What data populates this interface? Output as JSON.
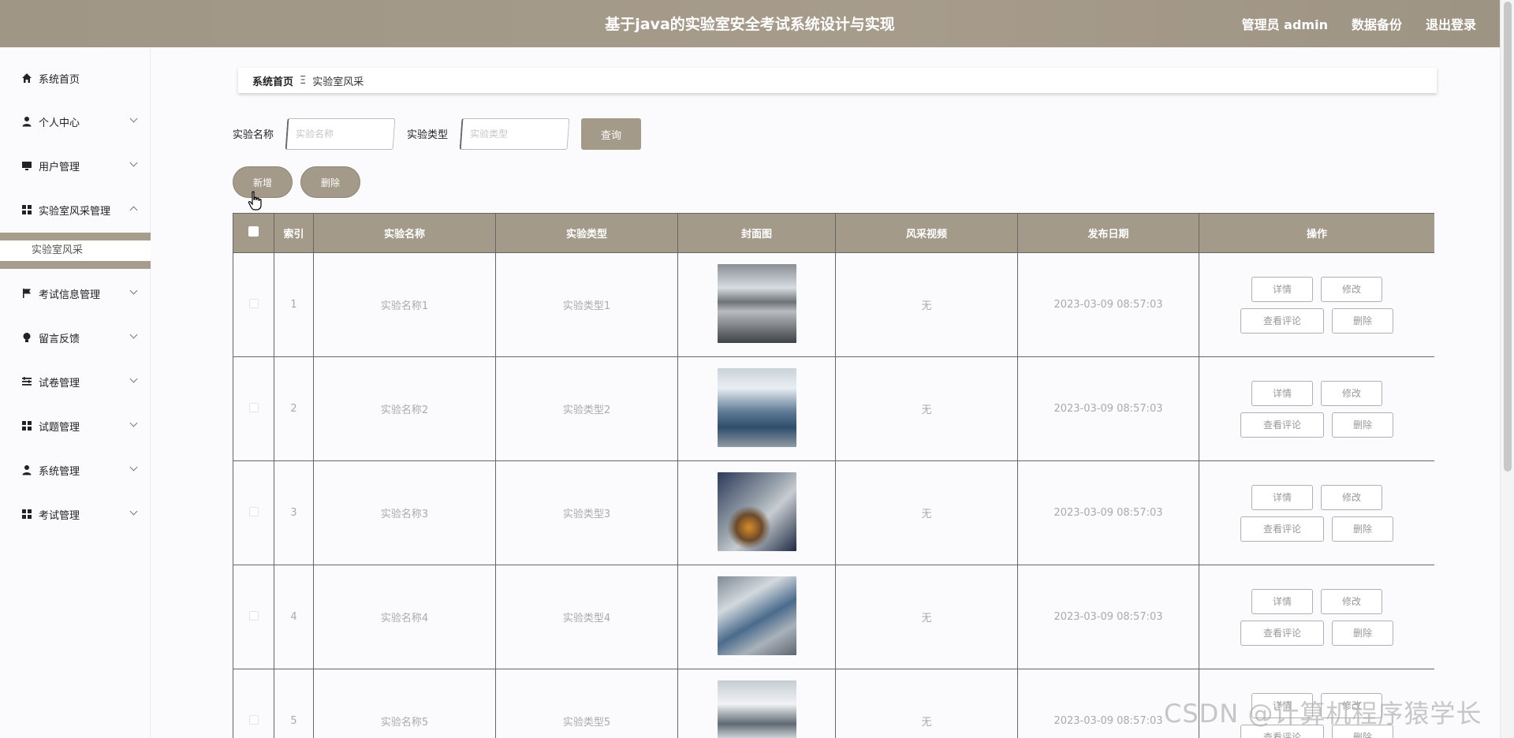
{
  "header": {
    "title": "基于java的实验室安全考试系统设计与实现",
    "admin_label": "管理员 admin",
    "backup_label": "数据备份",
    "logout_label": "退出登录"
  },
  "sidebar": {
    "items": [
      {
        "label": "系统首页",
        "icon": "home-icon"
      },
      {
        "label": "个人中心",
        "icon": "user-icon"
      },
      {
        "label": "用户管理",
        "icon": "monitor-icon"
      },
      {
        "label": "实验室风采管理",
        "icon": "grid-icon"
      },
      {
        "label": "考试信息管理",
        "icon": "flag-icon"
      },
      {
        "label": "留言反馈",
        "icon": "bulb-icon"
      },
      {
        "label": "试卷管理",
        "icon": "list-icon"
      },
      {
        "label": "试题管理",
        "icon": "grid-icon"
      },
      {
        "label": "系统管理",
        "icon": "user-icon"
      },
      {
        "label": "考试管理",
        "icon": "grid-icon"
      }
    ],
    "sub_item": "实验室风采"
  },
  "breadcrumb": {
    "home": "系统首页",
    "separator": "Ξ",
    "current": "实验室风采"
  },
  "search": {
    "name_label": "实验名称",
    "name_placeholder": "实验名称",
    "type_label": "实验类型",
    "type_placeholder": "实验类型",
    "query_label": "查询"
  },
  "actions": {
    "add_label": "新增",
    "delete_label": "删除"
  },
  "table": {
    "headers": [
      "索引",
      "实验名称",
      "实验类型",
      "封面图",
      "风采视频",
      "发布日期",
      "操作"
    ],
    "ops": {
      "detail": "详情",
      "edit": "修改",
      "comments": "查看评论",
      "delete": "删除"
    },
    "rows": [
      {
        "index": "1",
        "name": "实验名称1",
        "type": "实验类型1",
        "video": "无",
        "date": "2023-03-09 08:57:03"
      },
      {
        "index": "2",
        "name": "实验名称2",
        "type": "实验类型2",
        "video": "无",
        "date": "2023-03-09 08:57:03"
      },
      {
        "index": "3",
        "name": "实验名称3",
        "type": "实验类型3",
        "video": "无",
        "date": "2023-03-09 08:57:03"
      },
      {
        "index": "4",
        "name": "实验名称4",
        "type": "实验类型4",
        "video": "无",
        "date": "2023-03-09 08:57:03"
      },
      {
        "index": "5",
        "name": "实验名称5",
        "type": "实验类型5",
        "video": "无",
        "date": "2023-03-09 08:57:03"
      }
    ]
  },
  "watermark": "CSDN @计算机程序猿学长",
  "colors": {
    "accent": "#a39a8a",
    "header": "#a39a8a",
    "border": "#666666"
  }
}
